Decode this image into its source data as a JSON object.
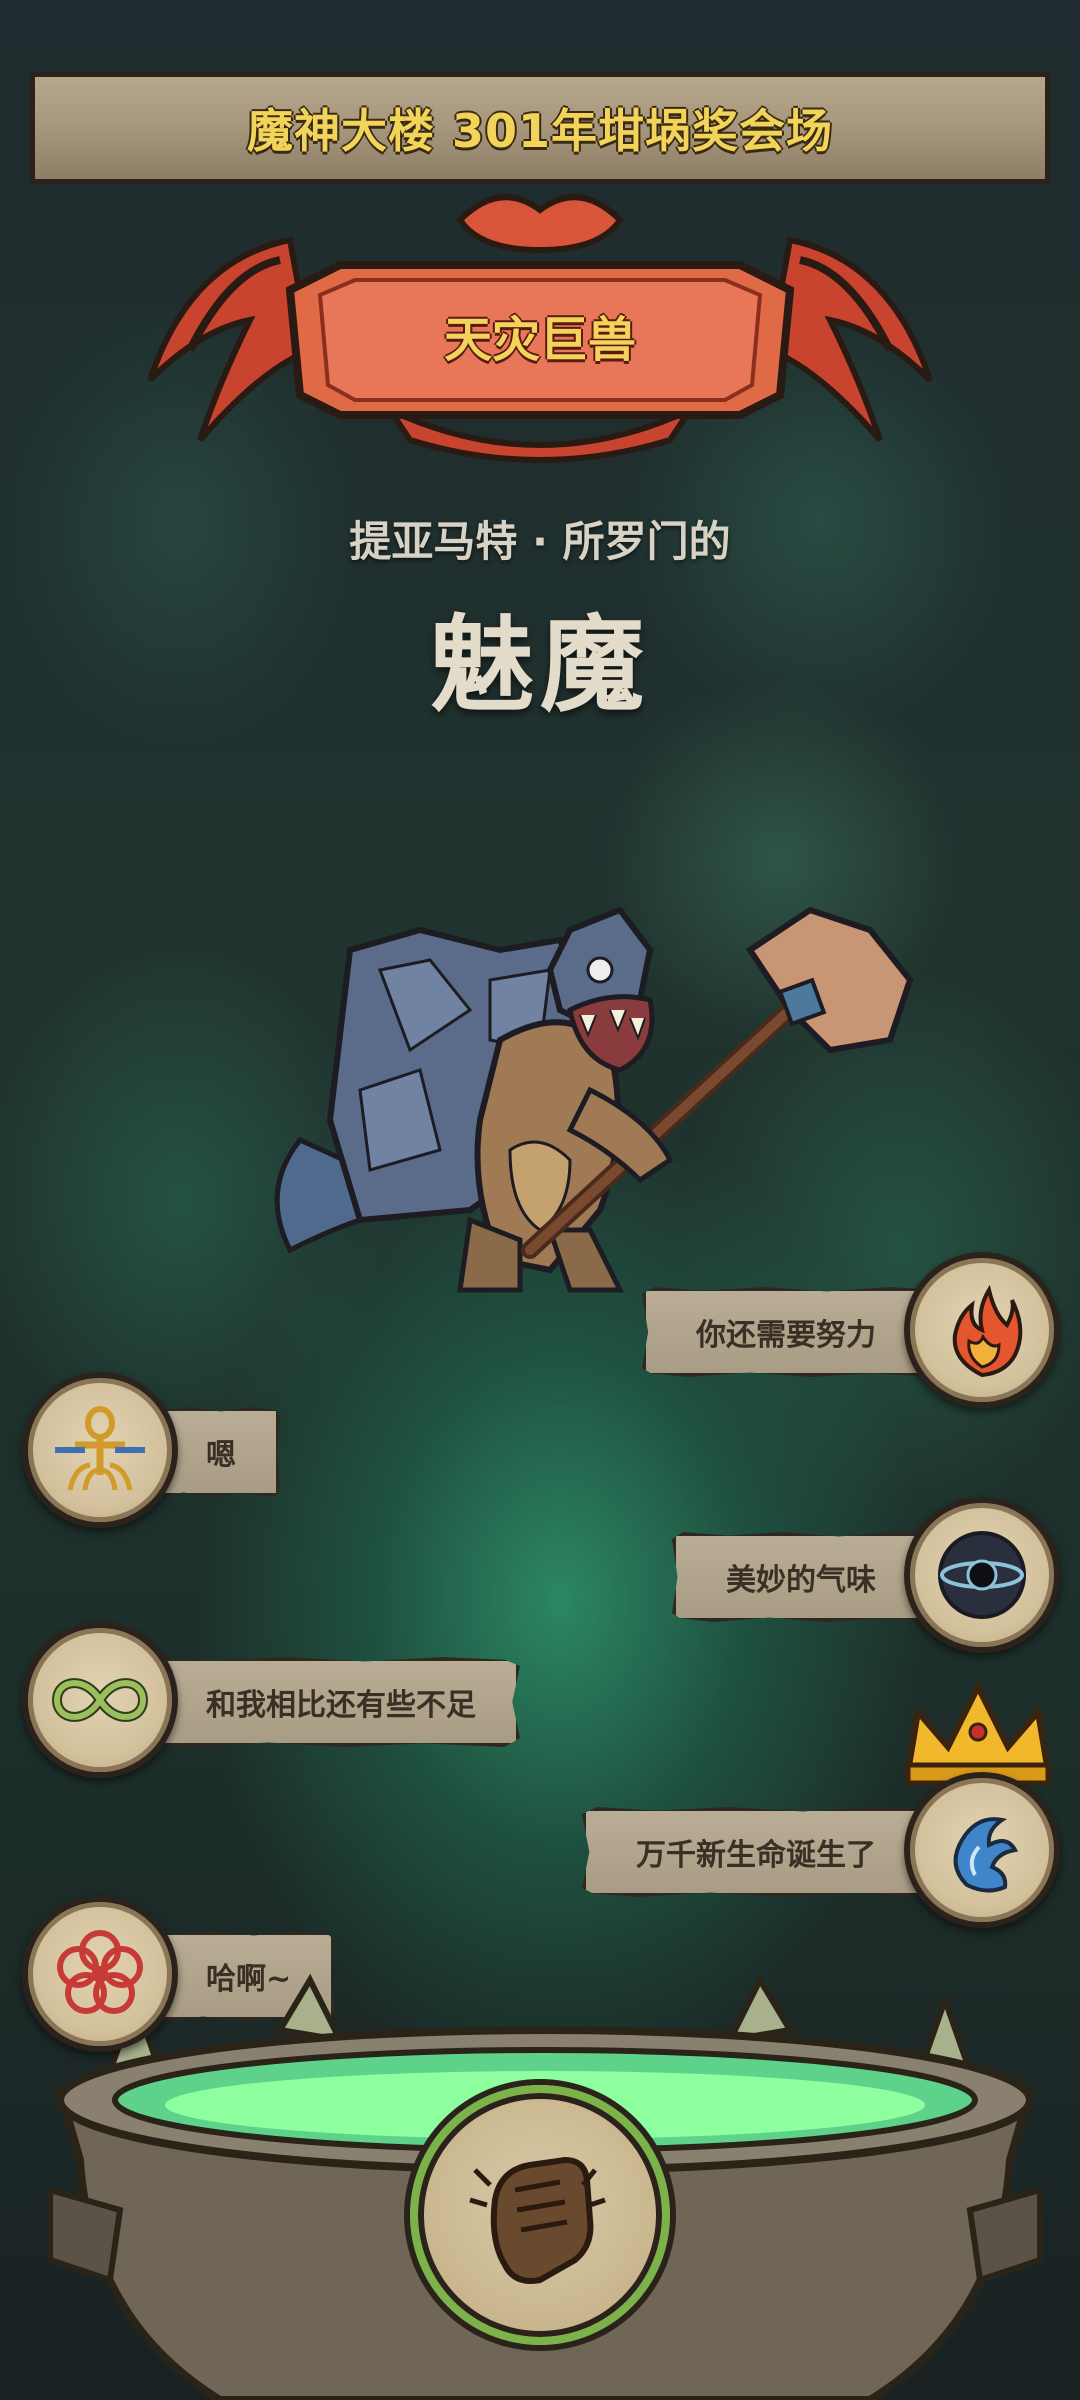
{
  "header": {
    "banner_title": "魔神大楼 301年坩埚奖会场"
  },
  "rank": {
    "label": "天灾巨兽"
  },
  "monster": {
    "owner_line": "提亚马特 · 所罗门的",
    "name": "魅魔"
  },
  "chat_messages": [
    {
      "side": "right",
      "icon": "flame-icon",
      "text": "你还需要努力"
    },
    {
      "side": "left",
      "icon": "ankh-icon",
      "text": "嗯"
    },
    {
      "side": "right",
      "icon": "dark-eye-icon",
      "text": "美妙的气味"
    },
    {
      "side": "left",
      "icon": "infinity-serpent-icon",
      "text": "和我相比还有些不足"
    },
    {
      "side": "right",
      "icon": "water-dragon-icon",
      "text": "万千新生命诞生了",
      "crowned": true
    },
    {
      "side": "left",
      "icon": "flower-knot-icon",
      "text": "哈啊~"
    }
  ],
  "action": {
    "icon": "fist-icon",
    "progress_ring_color": "#7bb34a"
  },
  "colors": {
    "title_gold": "#f2d45a",
    "emblem_red": "#d9553a",
    "cauldron_liquid": "#7dff9a"
  }
}
